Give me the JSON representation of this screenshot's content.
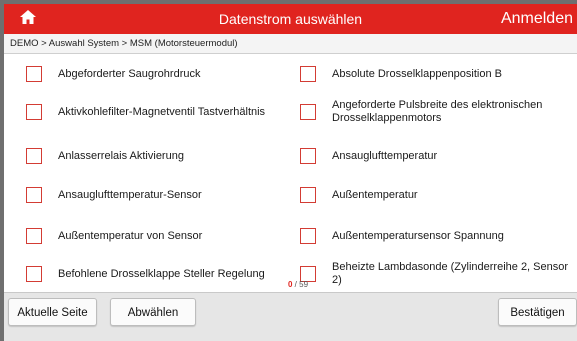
{
  "header": {
    "title": "Datenstrom auswählen",
    "login_label": "Anmelden",
    "home_icon": "home-icon"
  },
  "breadcrumb": "DEMO > Auswahl System > MSM (Motorsteuermodul)",
  "items_left": [
    {
      "label": "Abgeforderter Saugrohrdruck",
      "checked": false
    },
    {
      "label": "Aktivkohlefilter-Magnetventil Tastverhältnis",
      "checked": false
    },
    {
      "label": "Anlasserrelais Aktivierung",
      "checked": false
    },
    {
      "label": "Ansauglufttemperatur-Sensor",
      "checked": false
    },
    {
      "label": "Außentemperatur von Sensor",
      "checked": false
    },
    {
      "label": "Befohlene Drosselklappe Steller Regelung",
      "checked": false
    }
  ],
  "items_right": [
    {
      "label": "Absolute Drosselklappenposition B",
      "checked": false
    },
    {
      "label": "Angeforderte Pulsbreite des elektronischen Drosselklappenmotors",
      "checked": false
    },
    {
      "label": "Ansauglufttemperatur",
      "checked": false
    },
    {
      "label": "Außentemperatur",
      "checked": false
    },
    {
      "label": "Außentemperatursensor Spannung",
      "checked": false
    },
    {
      "label": "Beheizte Lambdasonde (Zylinderreihe 2, Sensor 2)",
      "checked": false
    }
  ],
  "counter": {
    "selected": "0",
    "separator": " / ",
    "total": "59"
  },
  "footer": {
    "current_page_label": "Aktuelle Seite",
    "deselect_label": "Abwählen",
    "confirm_label": "Bestätigen"
  },
  "colors": {
    "accent": "#e0241f",
    "checkbox": "#d33c34"
  }
}
